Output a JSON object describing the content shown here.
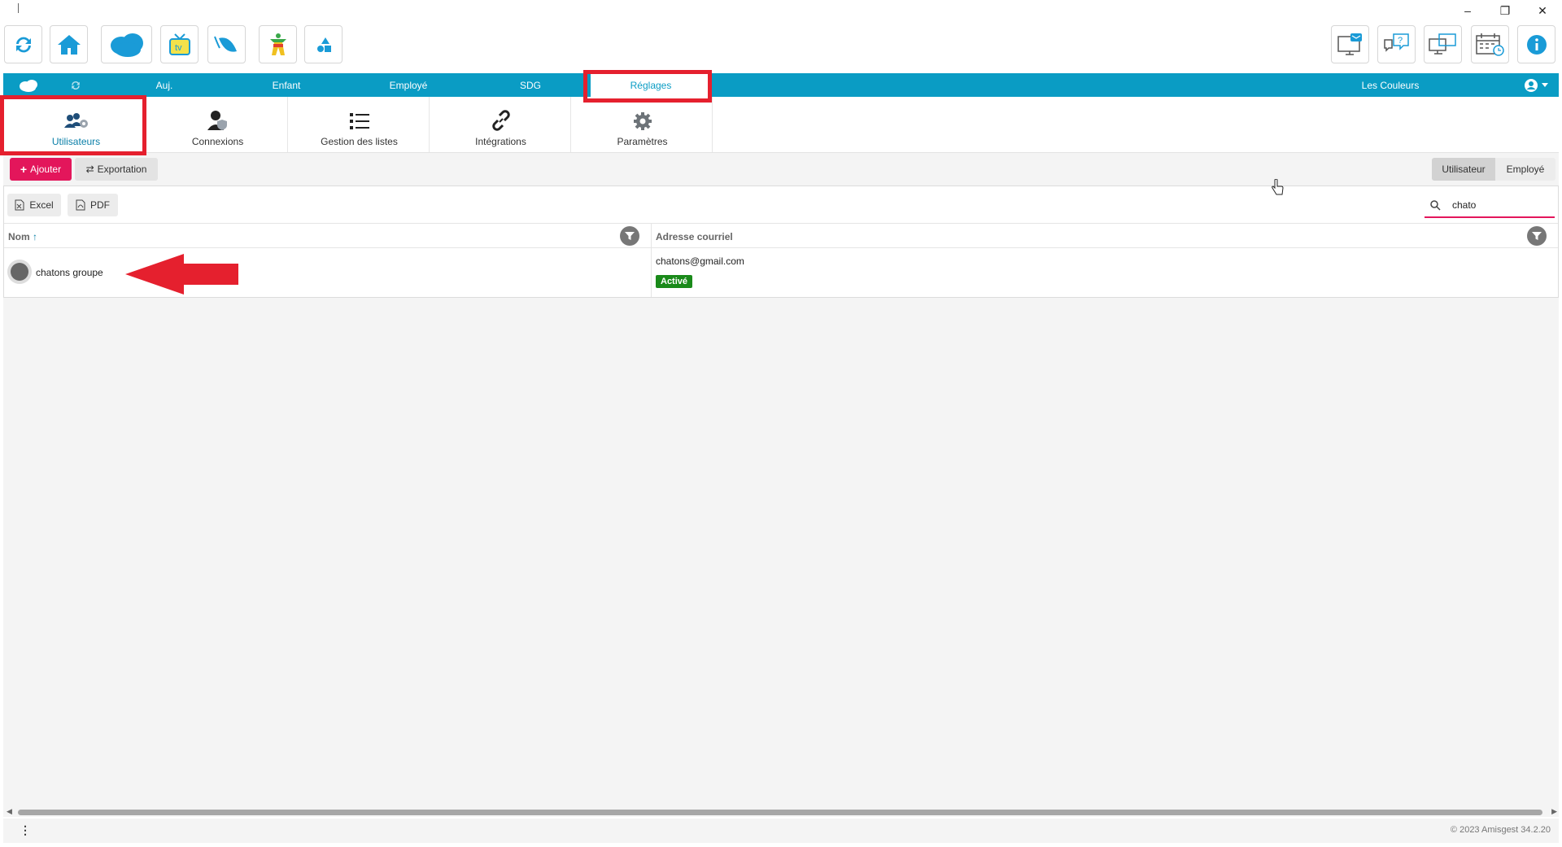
{
  "window": {
    "minimize": "–",
    "restore": "❐",
    "close": "✕"
  },
  "toolbar": {
    "left_icons": [
      "refresh-icon",
      "home-icon",
      "cloud-icon",
      "tv-icon",
      "leaf-icon",
      "character-icon",
      "shapes-icon"
    ],
    "right_icons": [
      "monitor-message-icon",
      "help-chat-icon",
      "screen-share-icon",
      "calendar-clock-icon",
      "info-icon"
    ]
  },
  "nav": {
    "items": [
      "Auj.",
      "Enfant",
      "Employé",
      "SDG",
      "Réglages"
    ],
    "active": "Réglages",
    "org_name": "Les Couleurs"
  },
  "subtabs": [
    {
      "label": "Utilisateurs",
      "icon": "users-gear-icon"
    },
    {
      "label": "Connexions",
      "icon": "user-shield-icon"
    },
    {
      "label": "Gestion des listes",
      "icon": "list-icon"
    },
    {
      "label": "Intégrations",
      "icon": "link-icon"
    },
    {
      "label": "Paramètres",
      "icon": "gear-icon"
    }
  ],
  "actions": {
    "add_label": "Ajouter",
    "export_label": "Exportation",
    "segment": [
      "Utilisateur",
      "Employé"
    ],
    "segment_active": "Utilisateur"
  },
  "grid": {
    "excel_label": "Excel",
    "pdf_label": "PDF",
    "search_value": "chato",
    "columns": [
      "Nom",
      "Adresse courriel"
    ],
    "rows": [
      {
        "name": "chatons groupe",
        "email": "chatons@gmail.com",
        "status": "Activé"
      }
    ]
  },
  "footer": {
    "copyright": "© 2023 Amisgest 34.2.20",
    "menu_glyph": "⋮"
  },
  "colors": {
    "nav_blue": "#0a9cc4",
    "accent_red": "#e3165b",
    "annotation_red": "#e5202e",
    "active_green": "#1a8a1a"
  }
}
